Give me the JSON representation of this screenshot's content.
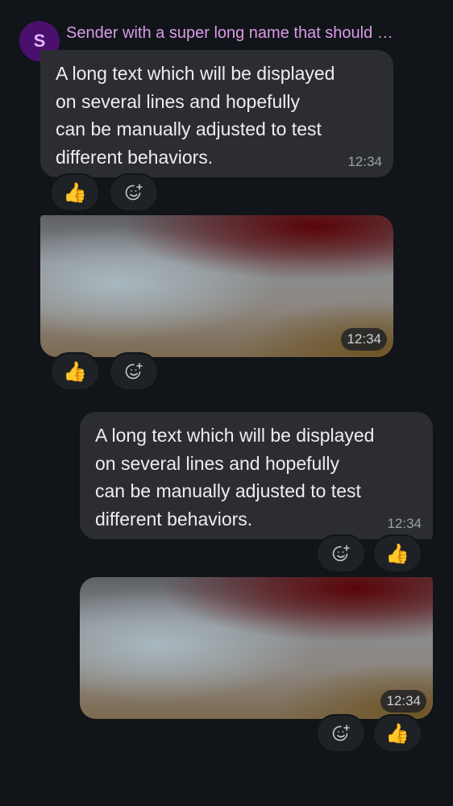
{
  "sender": {
    "avatar_letter": "S",
    "name": "Sender with a super long name that should …"
  },
  "messages": [
    {
      "type": "text",
      "direction": "incoming",
      "text": "A long text which will be displayed\non several lines and hopefully\ncan be manually adjusted to test\ndifferent behaviors.",
      "time": "12:34"
    },
    {
      "type": "image",
      "direction": "incoming",
      "time": "12:34"
    },
    {
      "type": "text",
      "direction": "outgoing",
      "text": "A long text which will be displayed\non several lines and hopefully\ncan be manually adjusted to test\ndifferent behaviors.",
      "time": "12:34"
    },
    {
      "type": "image",
      "direction": "outgoing",
      "time": "12:34"
    }
  ],
  "reactions": {
    "emoji": "👍",
    "add_icon": "add-reaction-icon"
  },
  "colors": {
    "background": "#111418",
    "bubble": "#2b2d32",
    "sender_name": "#d99be8",
    "avatar_bg": "#4b0f6e",
    "timestamp": "#9da1a7"
  }
}
